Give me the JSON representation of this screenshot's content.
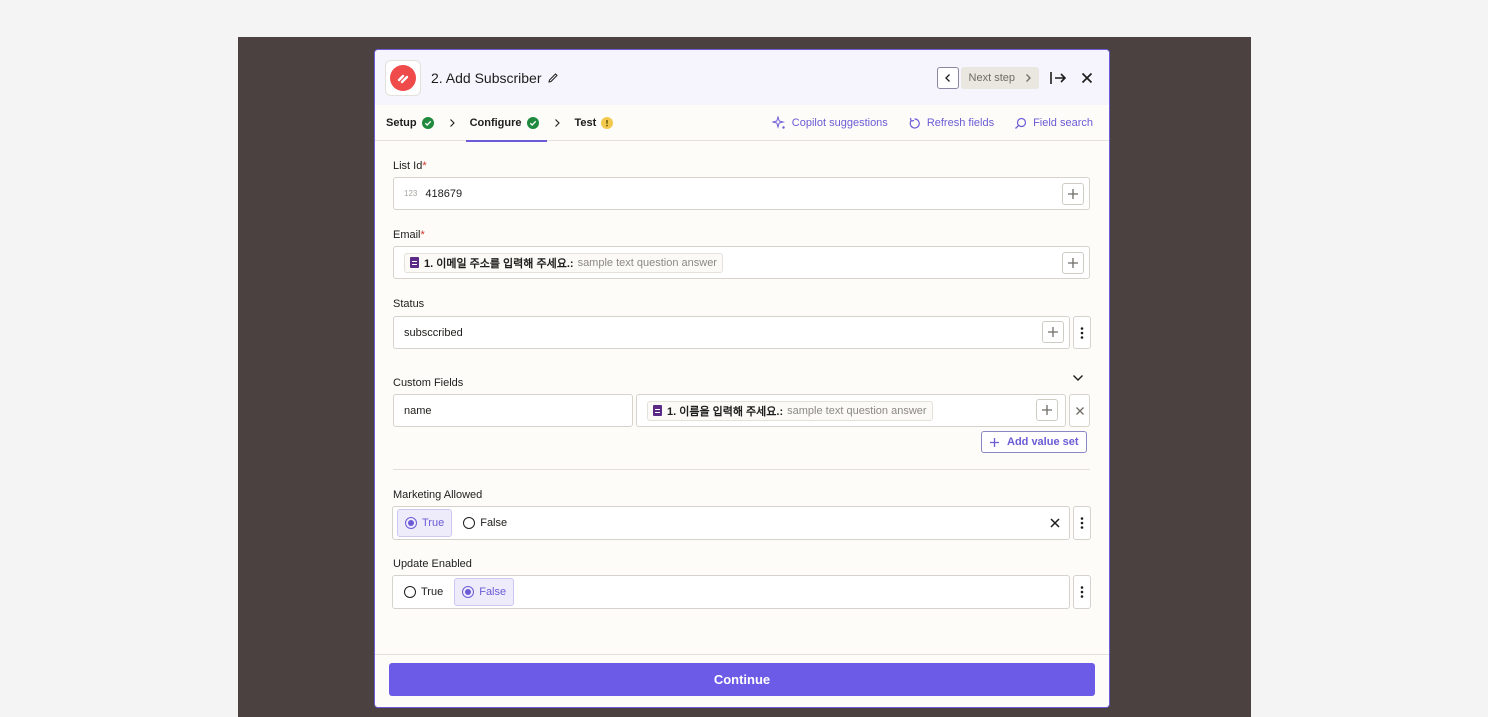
{
  "header": {
    "step_title": "2. Add Subscriber",
    "next_step_label": "Next step"
  },
  "tabs": [
    {
      "label": "Setup",
      "status": "complete"
    },
    {
      "label": "Configure",
      "status": "complete"
    },
    {
      "label": "Test",
      "status": "warning"
    }
  ],
  "tab_actions": {
    "copilot": "Copilot suggestions",
    "refresh": "Refresh fields",
    "search": "Field search"
  },
  "fields": {
    "list_id": {
      "label": "List Id",
      "required_mark": "*",
      "type_hint": "123",
      "value": "418679"
    },
    "email": {
      "label": "Email",
      "required_mark": "*",
      "question": "1. 이메일 주소를 입력해 주세요.:",
      "answer": "sample text question answer"
    },
    "status": {
      "label": "Status",
      "value": "subsccribed"
    },
    "custom_fields": {
      "label": "Custom Fields",
      "key": "name",
      "question": "1. 이름을 입력해 주세요.:",
      "answer": "sample text question answer",
      "add_value_set": "Add value set"
    },
    "marketing_allowed": {
      "label": "Marketing Allowed",
      "option_true": "True",
      "option_false": "False",
      "selected": "True"
    },
    "update_enabled": {
      "label": "Update Enabled",
      "option_true": "True",
      "option_false": "False",
      "selected": "False"
    }
  },
  "footer": {
    "continue_label": "Continue"
  },
  "colors": {
    "accent": "#6b5be6",
    "backdrop": "#4a4140",
    "success": "#1f8a3e",
    "warning": "#f2c94c",
    "brand": "#ef4b4b"
  }
}
